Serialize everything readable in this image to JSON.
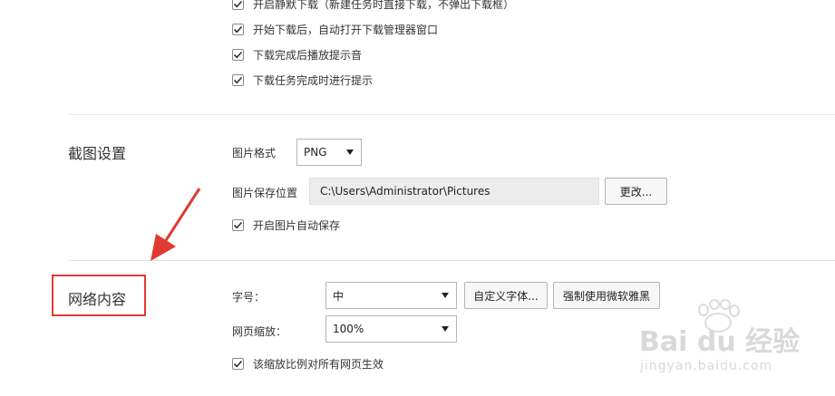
{
  "download": {
    "items": [
      {
        "label": "开启静默下载（新建任务时直接下载，不弹出下载框）",
        "checked": true
      },
      {
        "label": "开始下载后，自动打开下载管理器窗口",
        "checked": true
      },
      {
        "label": "下载完成后播放提示音",
        "checked": true
      },
      {
        "label": "下载任务完成时进行提示",
        "checked": true
      }
    ]
  },
  "screenshot": {
    "title": "截图设置",
    "format_label": "图片格式",
    "format_value": "PNG",
    "save_location_label": "图片保存位置",
    "save_path": "C:\\Users\\Administrator\\Pictures",
    "change_button": "更改...",
    "auto_save_label": "开启图片自动保存",
    "auto_save_checked": true
  },
  "web_content": {
    "title": "网络内容",
    "font_size_label": "字号：",
    "font_size_value": "中",
    "custom_font_button": "自定义字体...",
    "force_yahei_button": "强制使用微软雅黑",
    "zoom_label": "网页缩放：",
    "zoom_value": "100%",
    "apply_all_label": "该缩放比例对所有网页生效",
    "apply_all_checked": true
  },
  "annotation": {
    "highlight_color": "#e03a32"
  },
  "watermark": {
    "brand": "Bai du 经验",
    "url": "jingyan.baidu.com"
  }
}
